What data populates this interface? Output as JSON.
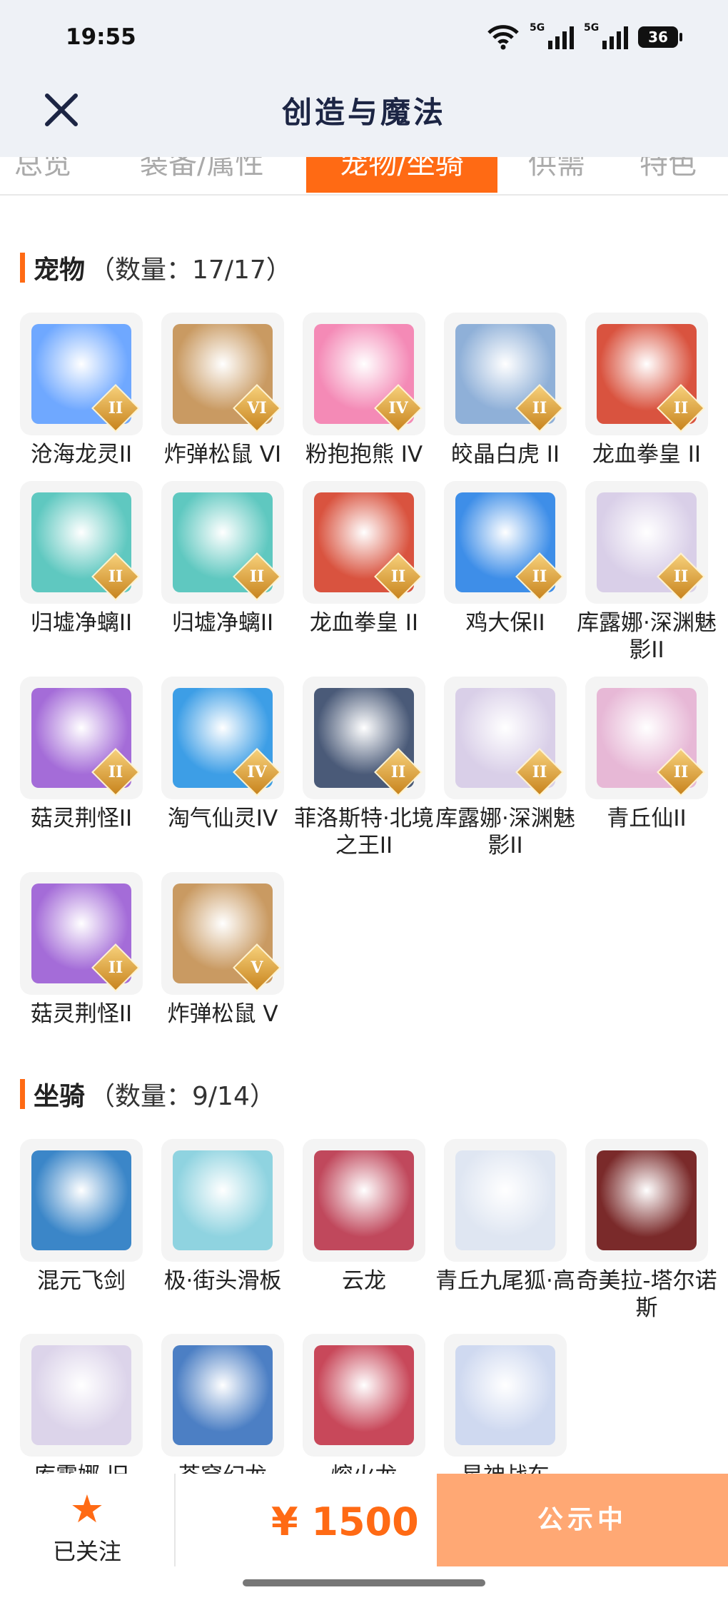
{
  "status_bar": {
    "time": "19:55",
    "network1": "5G",
    "network2": "5G",
    "battery": "36"
  },
  "header": {
    "title": "创造与魔法"
  },
  "tabs": [
    {
      "label": "总览"
    },
    {
      "label": "装备/属性"
    },
    {
      "label": "宠物/坐骑"
    },
    {
      "label": "供需"
    },
    {
      "label": "特色"
    }
  ],
  "pets": {
    "title": "宠物",
    "count": "（数量：17/17）",
    "items": [
      {
        "name": "沧海龙灵II",
        "tier": "II",
        "color": "#6fa8ff"
      },
      {
        "name": "炸弹松鼠 VI",
        "tier": "VI",
        "color": "#c99a62"
      },
      {
        "name": "粉抱抱熊 IV",
        "tier": "IV",
        "color": "#f48ab6"
      },
      {
        "name": "皎晶白虎 II",
        "tier": "II",
        "color": "#8fb0d8"
      },
      {
        "name": "龙血拳皇 II",
        "tier": "II",
        "color": "#d9533f"
      },
      {
        "name": "归墟净螭II",
        "tier": "II",
        "color": "#5fc8c0"
      },
      {
        "name": "归墟净螭II",
        "tier": "II",
        "color": "#5fc8c0"
      },
      {
        "name": "龙血拳皇 II",
        "tier": "II",
        "color": "#d9533f"
      },
      {
        "name": "鸡大保II",
        "tier": "II",
        "color": "#3e8ee8"
      },
      {
        "name": "库露娜·深渊魅影II",
        "tier": "II",
        "color": "#d9cfe8"
      },
      {
        "name": "菇灵荆怪II",
        "tier": "II",
        "color": "#a46cd8"
      },
      {
        "name": "淘气仙灵IV",
        "tier": "IV",
        "color": "#3d9ee6"
      },
      {
        "name": "菲洛斯特·北境之王II",
        "tier": "II",
        "color": "#4a5a78"
      },
      {
        "name": "库露娜·深渊魅影II",
        "tier": "II",
        "color": "#d9cfe8"
      },
      {
        "name": "青丘仙II",
        "tier": "II",
        "color": "#e7b8d6"
      },
      {
        "name": "菇灵荆怪II",
        "tier": "II",
        "color": "#a46cd8"
      },
      {
        "name": "炸弹松鼠 V",
        "tier": "V",
        "color": "#c99a62"
      }
    ]
  },
  "mounts": {
    "title": "坐骑",
    "count": "（数量：9/14）",
    "items": [
      {
        "name": "混元飞剑",
        "color": "#3b86c8"
      },
      {
        "name": "极·街头滑板",
        "color": "#8fd3e0"
      },
      {
        "name": "云龙",
        "color": "#c0485c"
      },
      {
        "name": "青丘九尾狐·高",
        "color": "#dfe6f2"
      },
      {
        "name": "奇美拉-塔尔诺斯",
        "color": "#7a2a2a"
      },
      {
        "name": "库露娜·旧",
        "color": "#dcd4ea"
      },
      {
        "name": "苍穹幻龙",
        "color": "#4c7fc4"
      },
      {
        "name": "熔火龙",
        "color": "#c8485a"
      },
      {
        "name": "星神战车",
        "color": "#cfd9f0"
      }
    ]
  },
  "bottom": {
    "follow_label": "已关注",
    "price": "¥ 1500",
    "status_label": "公示中"
  },
  "colors": {
    "accent": "#ff6a14",
    "status_button": "#ffa874",
    "header_bg": "#eef1f6"
  },
  "icons": {
    "close": "close-icon",
    "follow": "star-icon",
    "wifi": "wifi-icon"
  }
}
